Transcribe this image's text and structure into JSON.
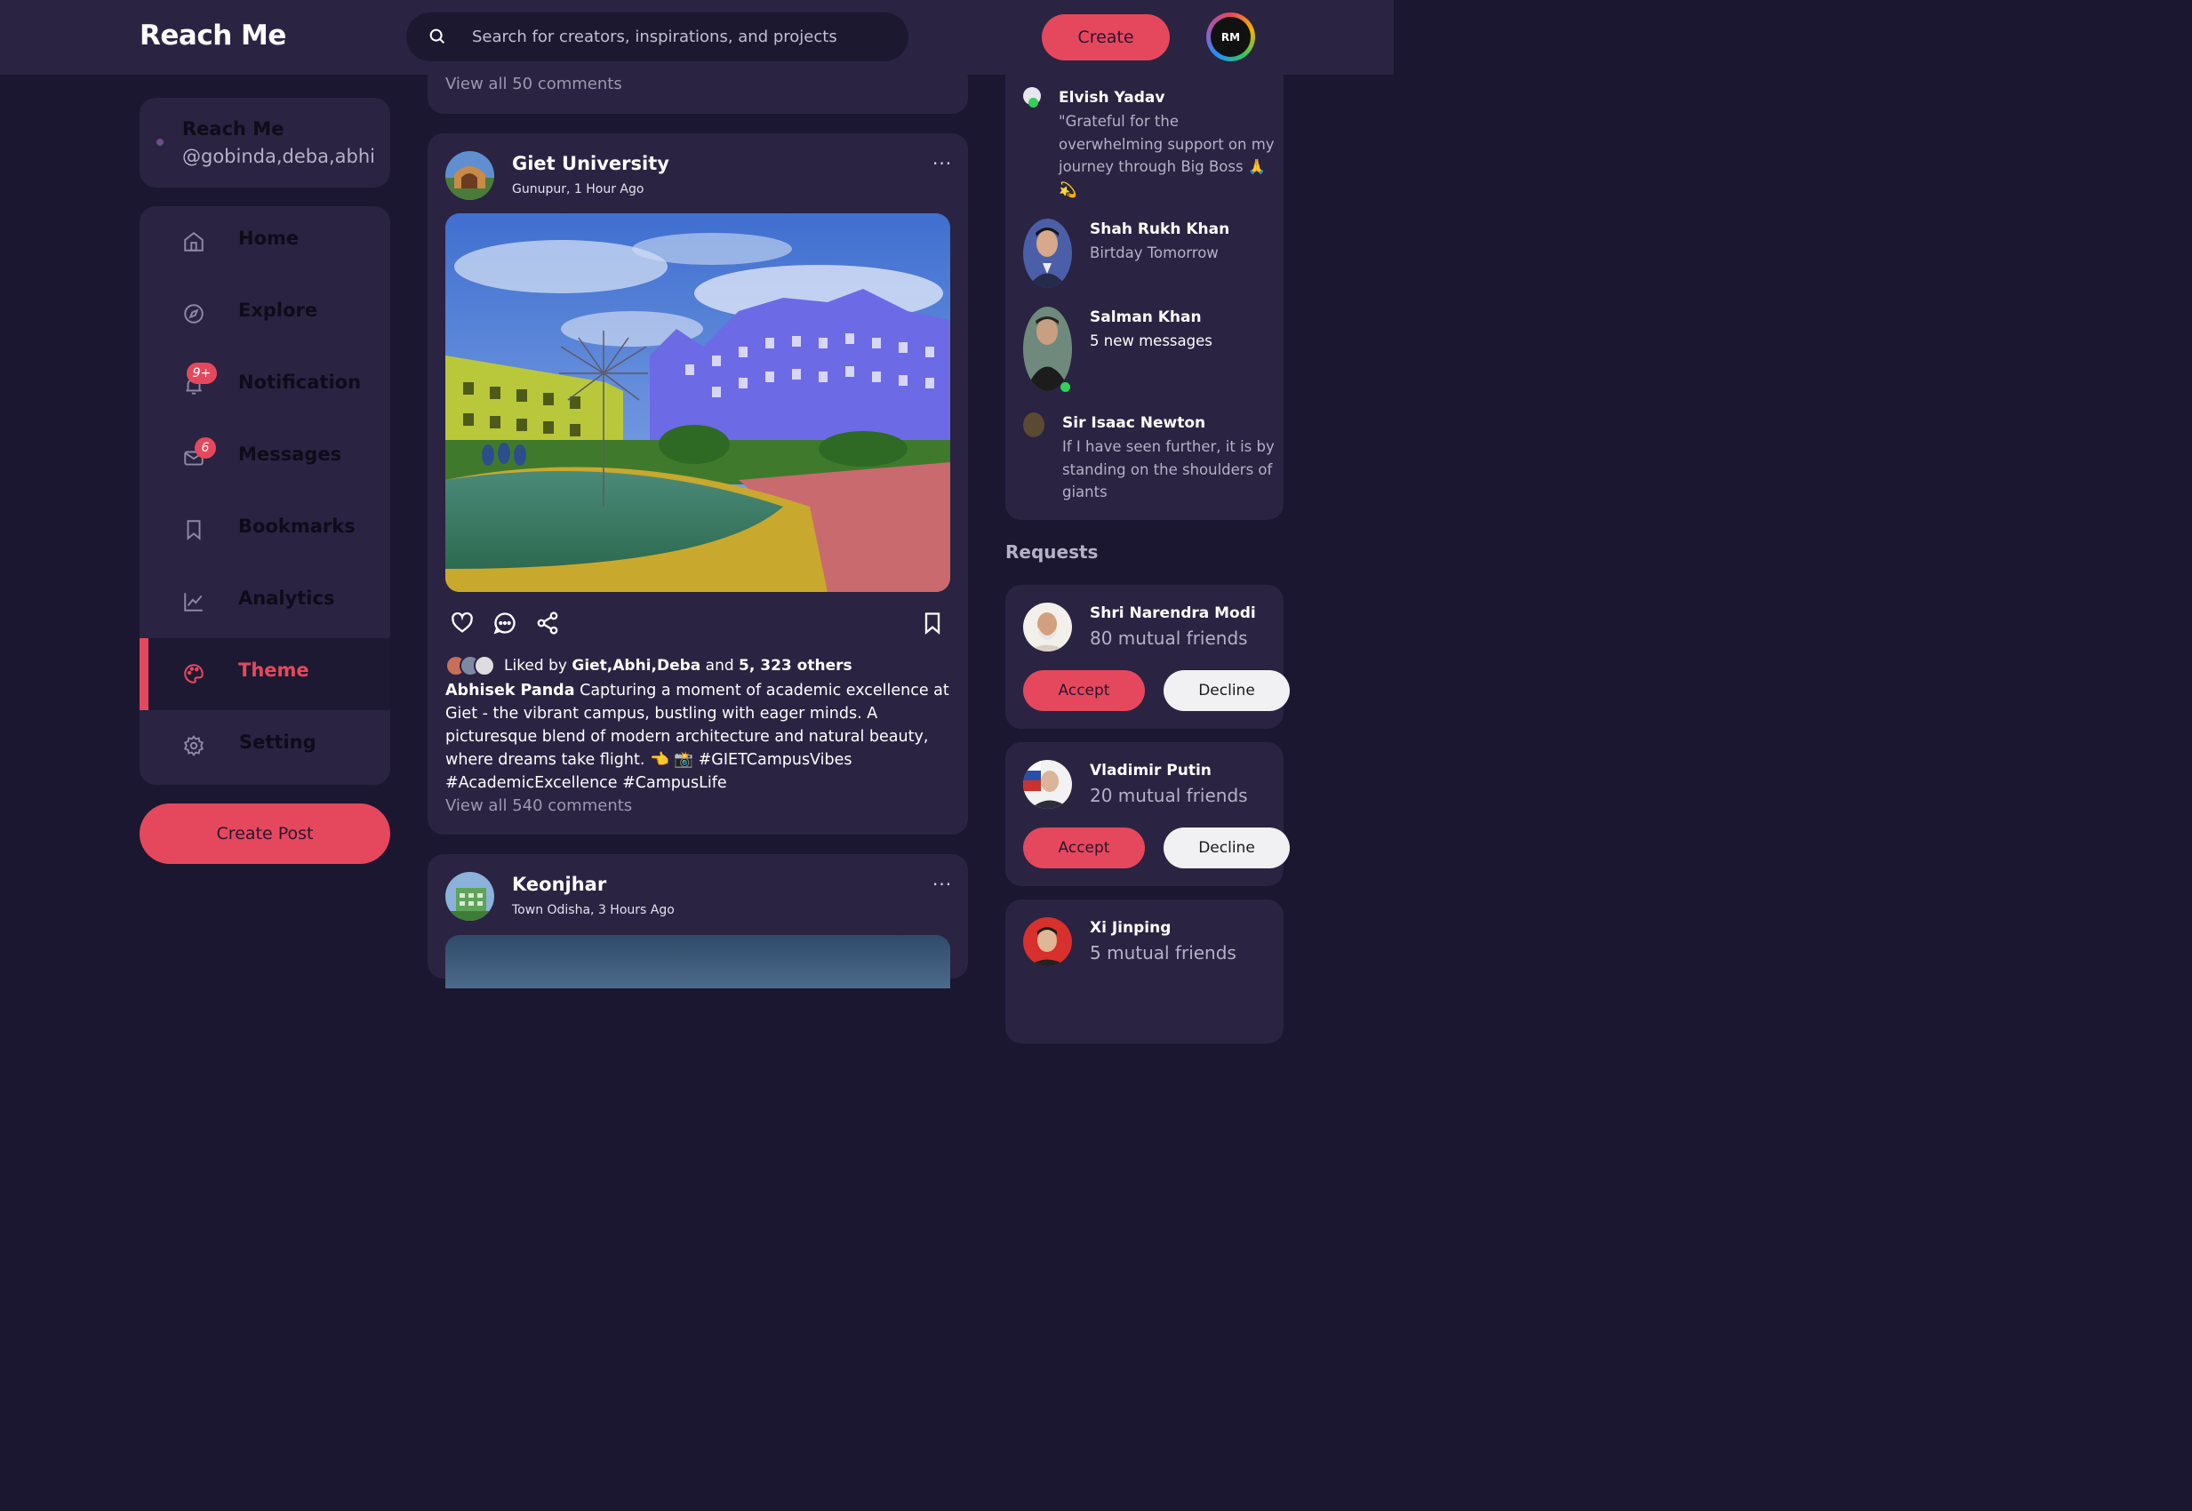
{
  "header": {
    "logo": "Reach Me",
    "search_placeholder": "Search for creators, inspirations, and projects",
    "create_label": "Create",
    "avatar_initials": "RM"
  },
  "profile": {
    "name": "Reach Me",
    "handle": "@gobinda,deba,abhi"
  },
  "menu": [
    {
      "label": "Home",
      "icon": "home-icon"
    },
    {
      "label": "Explore",
      "icon": "compass-icon"
    },
    {
      "label": "Notification",
      "icon": "bell-icon",
      "badge": "9+"
    },
    {
      "label": "Messages",
      "icon": "mail-icon",
      "badge": "6"
    },
    {
      "label": "Bookmarks",
      "icon": "bookmark-icon"
    },
    {
      "label": "Analytics",
      "icon": "chart-icon"
    },
    {
      "label": "Theme",
      "icon": "palette-icon",
      "active": true
    },
    {
      "label": "Setting",
      "icon": "gear-icon"
    }
  ],
  "create_post_label": "Create Post",
  "feed": {
    "prev_post_comments": "View all 50 comments",
    "post": {
      "author": "Giet University",
      "meta": "Gunupur, 1 Hour Ago",
      "more": "···",
      "liked_prefix": "Liked by",
      "liked_names": "Giet,Abhi,Deba",
      "liked_and": "and",
      "liked_others": "5, 323 others",
      "caption_author": "Abhisek Panda",
      "caption": "Capturing a moment of academic excellence at Giet - the vibrant campus, bustling with eager minds. A picturesque blend of modern architecture and natural beauty, where dreams take flight. 👈 📸 #GIETCampusVibes #AcademicExcellence #CampusLife",
      "comments": "View all 540 comments"
    },
    "post2": {
      "author": "Keonjhar",
      "meta": "Town Odisha, 3 Hours Ago",
      "more": "···"
    }
  },
  "messages": [
    {
      "name": "Elvish Yadav",
      "text": "\"Grateful for the overwhelming support on my journey through Big Boss 🙏💫",
      "online": true
    },
    {
      "name": "Shah Rukh Khan",
      "text": "Birtday Tomorrow",
      "online": false
    },
    {
      "name": "Salman Khan",
      "text": "5 new messages",
      "online": true
    },
    {
      "name": "Sir Isaac Newton",
      "text": "If I have seen further, it is by standing on the shoulders of giants",
      "online": false
    }
  ],
  "requests": {
    "title": "Requests",
    "accept_label": "Accept",
    "decline_label": "Decline",
    "items": [
      {
        "name": "Shri Narendra Modi",
        "mutual": "80 mutual friends"
      },
      {
        "name": "Vladimir Putin",
        "mutual": "20 mutual friends"
      },
      {
        "name": "Xi Jinping",
        "mutual": "5 mutual friends"
      }
    ]
  },
  "colors": {
    "accent": "#e5485d",
    "panel": "#2a2342",
    "background": "#1b1730",
    "online": "#31d158"
  }
}
